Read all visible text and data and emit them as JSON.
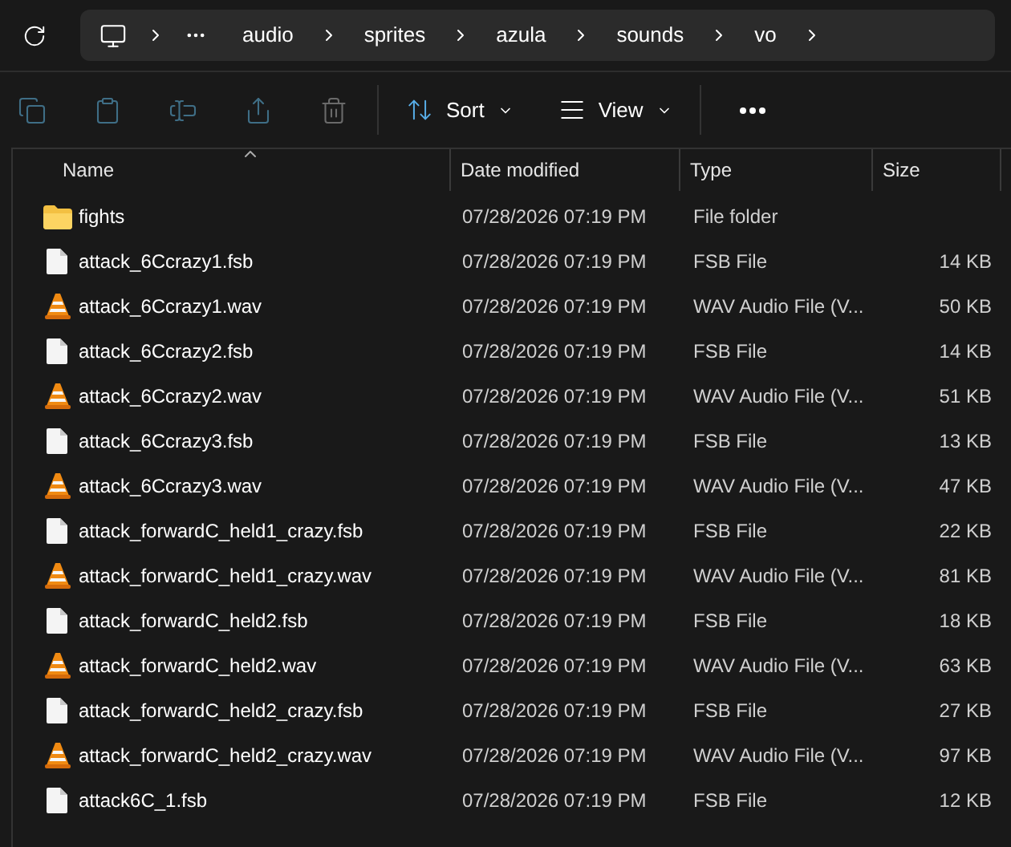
{
  "breadcrumbs": [
    "audio",
    "sprites",
    "azula",
    "sounds",
    "vo"
  ],
  "toolbar": {
    "sort": "Sort",
    "view": "View"
  },
  "columns": [
    {
      "label": "Name",
      "sorted": true
    },
    {
      "label": "Date modified",
      "sorted": false
    },
    {
      "label": "Type",
      "sorted": false
    },
    {
      "label": "Size",
      "sorted": false
    }
  ],
  "rows": [
    {
      "kind": "folder",
      "name": "fights",
      "date": "07/28/2026 07:19 PM",
      "type": "File folder"
    },
    {
      "kind": "fsb",
      "name": "attack_6Ccrazy1.fsb",
      "date": "07/28/2026 07:19 PM",
      "type": "FSB File",
      "size": "14 KB"
    },
    {
      "kind": "wav",
      "name": "attack_6Ccrazy1.wav",
      "date": "07/28/2026 07:19 PM",
      "type": "WAV Audio File (V...",
      "size": "50 KB"
    },
    {
      "kind": "fsb",
      "name": "attack_6Ccrazy2.fsb",
      "date": "07/28/2026 07:19 PM",
      "type": "FSB File",
      "size": "14 KB"
    },
    {
      "kind": "wav",
      "name": "attack_6Ccrazy2.wav",
      "date": "07/28/2026 07:19 PM",
      "type": "WAV Audio File (V...",
      "size": "51 KB"
    },
    {
      "kind": "fsb",
      "name": "attack_6Ccrazy3.fsb",
      "date": "07/28/2026 07:19 PM",
      "type": "FSB File",
      "size": "13 KB"
    },
    {
      "kind": "wav",
      "name": "attack_6Ccrazy3.wav",
      "date": "07/28/2026 07:19 PM",
      "type": "WAV Audio File (V...",
      "size": "47 KB"
    },
    {
      "kind": "fsb",
      "name": "attack_forwardC_held1_crazy.fsb",
      "date": "07/28/2026 07:19 PM",
      "type": "FSB File",
      "size": "22 KB"
    },
    {
      "kind": "wav",
      "name": "attack_forwardC_held1_crazy.wav",
      "date": "07/28/2026 07:19 PM",
      "type": "WAV Audio File (V...",
      "size": "81 KB"
    },
    {
      "kind": "fsb",
      "name": "attack_forwardC_held2.fsb",
      "date": "07/28/2026 07:19 PM",
      "type": "FSB File",
      "size": "18 KB"
    },
    {
      "kind": "wav",
      "name": "attack_forwardC_held2.wav",
      "date": "07/28/2026 07:19 PM",
      "type": "WAV Audio File (V...",
      "size": "63 KB"
    },
    {
      "kind": "fsb",
      "name": "attack_forwardC_held2_crazy.fsb",
      "date": "07/28/2026 07:19 PM",
      "type": "FSB File",
      "size": "27 KB"
    },
    {
      "kind": "wav",
      "name": "attack_forwardC_held2_crazy.wav",
      "date": "07/28/2026 07:19 PM",
      "type": "WAV Audio File (V...",
      "size": "97 KB"
    },
    {
      "kind": "fsb",
      "name": "attack6C_1.fsb",
      "date": "07/28/2026 07:19 PM",
      "type": "FSB File",
      "size": "12 KB"
    }
  ]
}
